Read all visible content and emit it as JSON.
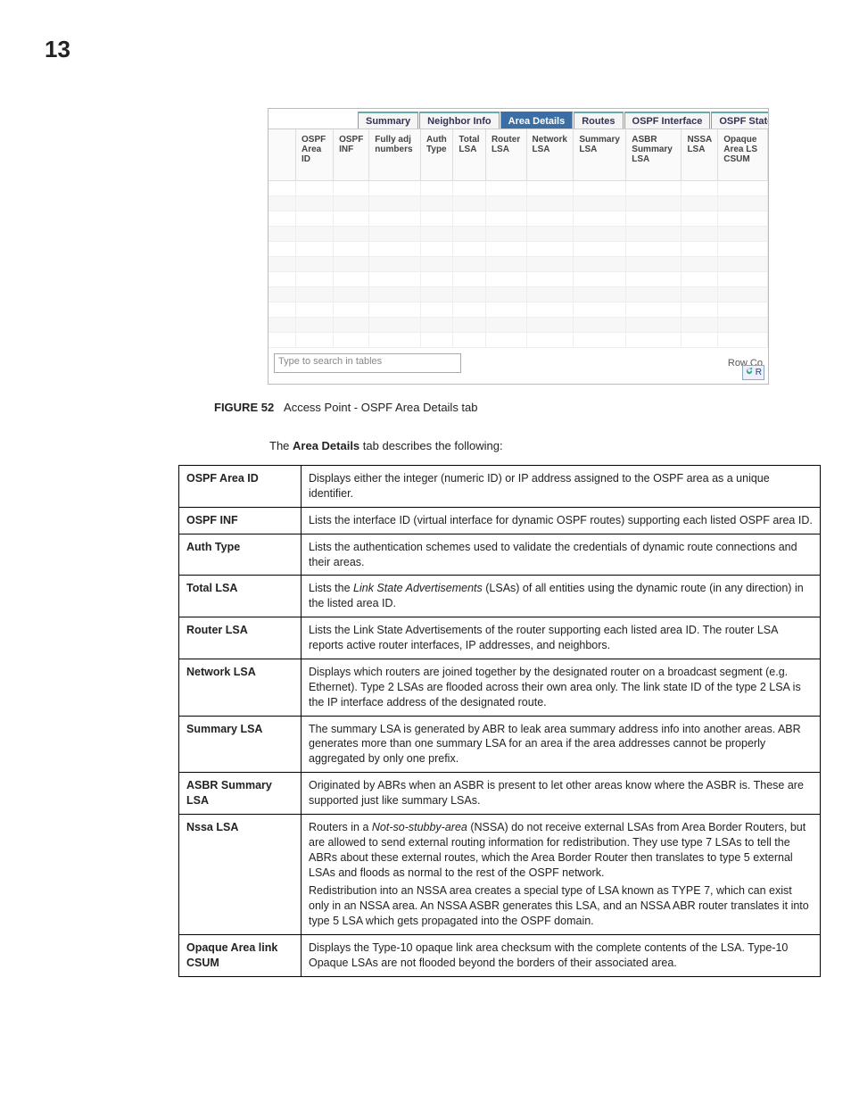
{
  "chapter": "13",
  "screenshot": {
    "tabs": [
      "Summary",
      "Neighbor Info",
      "Area Details",
      "Routes",
      "OSPF Interface",
      "OSPF State"
    ],
    "active_tab": "Area Details",
    "columns": [
      "OSPF Area ID",
      "OSPF INF",
      "Fully adj numbers",
      "Auth Type",
      "Total LSA",
      "Router LSA",
      "Network LSA",
      "Summary LSA",
      "ASBR Summary LSA",
      "NSSA LSA",
      "Opaque Area LS CSUM"
    ],
    "search_placeholder": "Type to search in tables",
    "row_count_label": "Row Co",
    "refresh_label": "R"
  },
  "figure": {
    "label": "FIGURE 52",
    "caption": "Access Point - OSPF Area Details tab"
  },
  "lead": {
    "pre": "The ",
    "bold": "Area Details",
    "post": " tab describes the following:"
  },
  "definitions": [
    {
      "term": "OSPF Area ID",
      "desc": "Displays either the integer (numeric ID) or IP address assigned to the OSPF area as a unique identifier."
    },
    {
      "term": "OSPF INF",
      "desc": "Lists the interface ID (virtual interface for dynamic OSPF routes) supporting each listed OSPF area ID."
    },
    {
      "term": "Auth Type",
      "desc": "Lists the authentication schemes used to validate the credentials of dynamic route connections and their areas."
    },
    {
      "term": "Total LSA",
      "desc_pre": "Lists the ",
      "desc_ital": "Link State Advertisements",
      "desc_post": " (LSAs) of all entities using the dynamic route (in any direction) in the listed area ID."
    },
    {
      "term": "Router LSA",
      "desc": "Lists the Link State Advertisements of the router supporting each listed area ID. The router LSA reports active router interfaces, IP addresses, and neighbors."
    },
    {
      "term": "Network LSA",
      "desc": "Displays which routers are joined together by the designated router on a broadcast segment (e.g. Ethernet). Type 2 LSAs are flooded across their own area only. The link state ID of the type 2 LSA is the IP interface address of the designated route."
    },
    {
      "term": "Summary LSA",
      "desc": "The summary LSA is generated by ABR to leak area summary address info into another areas. ABR generates more than one summary LSA for an area if the area addresses cannot be properly aggregated by only one prefix."
    },
    {
      "term": "ASBR Summary LSA",
      "desc": "Originated by ABRs when an ASBR is present to let other areas know where the ASBR is. These are supported just like summary LSAs."
    },
    {
      "term": "Nssa LSA",
      "desc_pre": "Routers in a ",
      "desc_ital": "Not-so-stubby-area",
      "desc_post": " (NSSA) do not receive external LSAs from Area Border Routers, but are allowed to send external routing information for redistribution. They use type 7 LSAs to tell the ABRs about these external routes, which the Area Border Router then translates to type 5 external LSAs and floods as normal to the rest of the OSPF network.",
      "desc_para2": "Redistribution into an NSSA area creates a special type of LSA known as TYPE 7, which can exist only in an NSSA area. An NSSA ASBR generates this LSA, and an NSSA ABR router translates it into type 5 LSA which gets propagated into the OSPF domain."
    },
    {
      "term": "Opaque Area link CSUM",
      "desc": "Displays the Type-10 opaque link area checksum with the complete contents of the LSA. Type-10 Opaque LSAs are not flooded beyond the borders of their associated area."
    }
  ]
}
